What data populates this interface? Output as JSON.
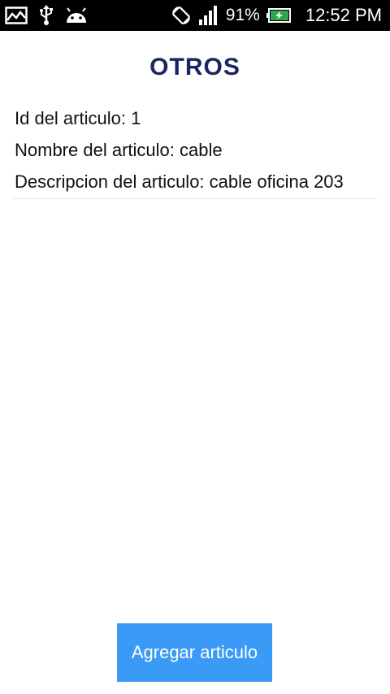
{
  "status_bar": {
    "icons_left": [
      "gallery-icon",
      "usb-icon",
      "android-icon"
    ],
    "icons_right": [
      "auto-rotate-icon",
      "signal-icon",
      "battery-charging-icon"
    ],
    "battery_percent": "91%",
    "time": "12:52 PM"
  },
  "page": {
    "title": "OTROS"
  },
  "article": {
    "id_line": "Id del articulo: 1",
    "name_line": "Nombre del articulo: cable",
    "description_line": "Descripcion del articulo: cable oficina 203"
  },
  "actions": {
    "add_label": "Agregar articulo"
  },
  "colors": {
    "title": "#1a2660",
    "button": "#3a9af5",
    "status_bar": "#000000"
  }
}
